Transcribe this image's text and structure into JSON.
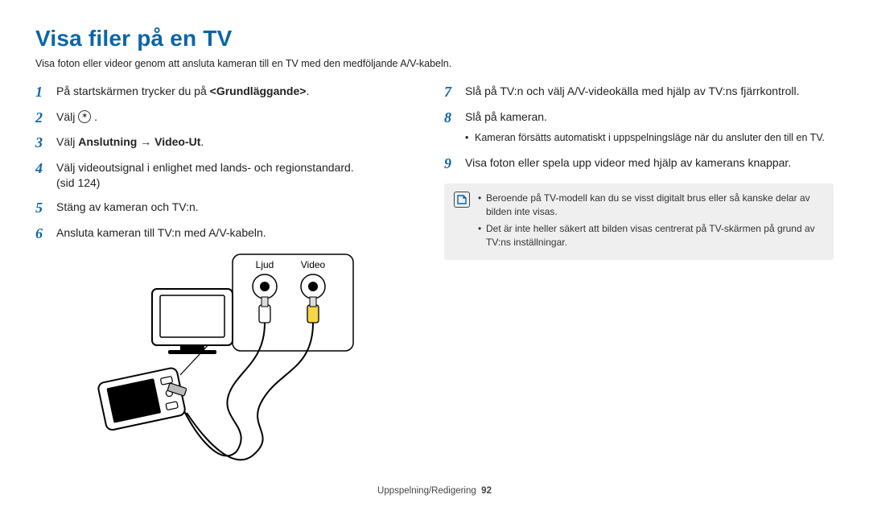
{
  "title": "Visa filer på en TV",
  "intro": "Visa foton eller videor genom att ansluta kameran till en TV med den medföljande A/V-kabeln.",
  "left": {
    "s1": {
      "num": "1",
      "a": "På startskärmen trycker du på ",
      "b": "<Grundläggande>",
      "c": "."
    },
    "s2": {
      "num": "2",
      "a": "Välj ",
      "c": "."
    },
    "s3": {
      "num": "3",
      "a": "Välj ",
      "b": "Anslutning → Video-Ut",
      "c": "."
    },
    "s4": {
      "num": "4",
      "a": "Välj videoutsignal i enlighet med lands- och regionstandard.",
      "p": "(sid 124)"
    },
    "s5": {
      "num": "5",
      "a": "Stäng av kameran och TV:n."
    },
    "s6": {
      "num": "6",
      "a": "Ansluta kameran till TV:n med A/V-kabeln."
    }
  },
  "right": {
    "s7": {
      "num": "7",
      "a": "Slå på TV:n och välj A/V-videokälla med hjälp av TV:ns fjärrkontroll."
    },
    "s8": {
      "num": "8",
      "a": "Slå på kameran.",
      "sub1": "Kameran försätts automatiskt i uppspelningsläge när du ansluter den till en TV."
    },
    "s9": {
      "num": "9",
      "a": "Visa foton eller spela upp videor med hjälp av kamerans knappar."
    }
  },
  "note": {
    "item1": "Beroende på TV-modell kan du se visst digitalt brus eller så kanske delar av bilden inte visas.",
    "item2": "Det är inte heller säkert att bilden visas centrerat på TV-skärmen på grund av TV:ns inställningar."
  },
  "diagram": {
    "audio_label": "Ljud",
    "video_label": "Video"
  },
  "footer": {
    "section": "Uppspelning/Redigering",
    "page": "92"
  },
  "chart_data": {
    "type": "diagram",
    "description": "Anslutningsillustration: kamera → A/V-kabel → TV; Ljud (vit) och Video (gul) RCA-kontakter i inzoomad ruta."
  }
}
